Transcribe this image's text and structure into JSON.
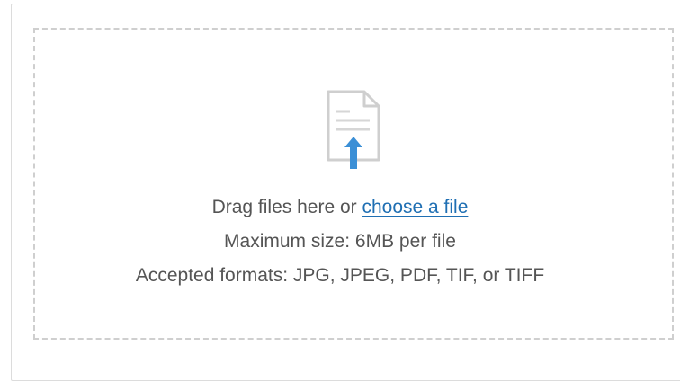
{
  "dropzone": {
    "prompt_prefix": "Drag files here or ",
    "choose_link_label": "choose a file",
    "max_size_text": "Maximum size: 6MB per file",
    "accepted_formats_text": "Accepted formats: JPG, JPEG, PDF, TIF, or TIFF",
    "icon": "document-upload-icon"
  },
  "colors": {
    "link": "#1f6fb3",
    "icon_arrow": "#3b8fd6",
    "icon_outline": "#cfcfcf",
    "text": "#555555",
    "dash_border": "#cfcfcf"
  }
}
